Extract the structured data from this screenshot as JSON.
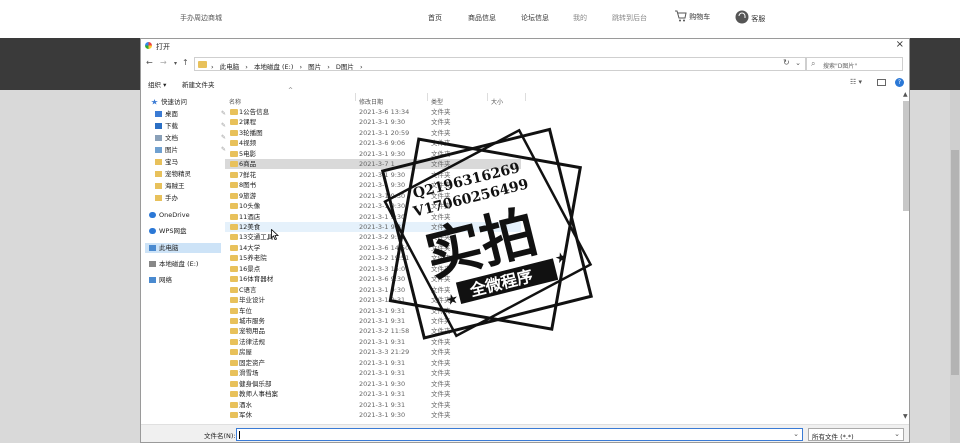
{
  "site": {
    "logo": "手办周边商城",
    "nav": [
      {
        "label": "首页",
        "dim": false
      },
      {
        "label": "商品信息",
        "dim": false
      },
      {
        "label": "论坛信息",
        "dim": false
      },
      {
        "label": "我的",
        "dim": true
      },
      {
        "label": "跳转到后台",
        "dim": true
      },
      {
        "label": "购物车",
        "dim": false
      },
      {
        "label": "客服",
        "dim": false
      }
    ]
  },
  "dialog": {
    "title": "打开",
    "close": "×",
    "breadcrumbs": [
      "此电脑",
      "›",
      "本地磁盘 (E:)",
      "›",
      "图片",
      "›",
      "D图片",
      "›"
    ],
    "search_placeholder": "搜索\"D图片\"",
    "toolbar": {
      "organize": "组织 ▾",
      "new_folder": "新建文件夹"
    },
    "columns": {
      "name": "名称",
      "date": "修改日期",
      "type": "类型",
      "size": "大小"
    },
    "sidebar": [
      {
        "label": "快速访问",
        "icon": "star-icon",
        "color": "#3b7bd4"
      },
      {
        "label": "桌面",
        "icon": "desktop-icon",
        "color": "#3b7bd4",
        "pin": true
      },
      {
        "label": "下载",
        "icon": "download-icon",
        "color": "#2b6fc4",
        "pin": true
      },
      {
        "label": "文档",
        "icon": "document-icon",
        "color": "#8aa0b8",
        "pin": true
      },
      {
        "label": "图片",
        "icon": "picture-icon",
        "color": "#6fa0d0",
        "pin": true
      },
      {
        "label": "宝马",
        "icon": "folder-icon",
        "color": "#e8c15b"
      },
      {
        "label": "宠物精灵",
        "icon": "folder-icon",
        "color": "#e8c15b"
      },
      {
        "label": "海贼王",
        "icon": "folder-icon",
        "color": "#e8c15b"
      },
      {
        "label": "手办",
        "icon": "folder-icon",
        "color": "#e8c15b"
      },
      {
        "label": "OneDrive",
        "icon": "cloud-icon",
        "color": "#2b78d6"
      },
      {
        "label": "WPS网盘",
        "icon": "cloud-icon",
        "color": "#2b78d6"
      },
      {
        "label": "此电脑",
        "icon": "computer-icon",
        "color": "#4a8ad0",
        "selected": true
      },
      {
        "label": "本地磁盘 (E:)",
        "icon": "drive-icon",
        "color": "#888888"
      },
      {
        "label": "网络",
        "icon": "network-icon",
        "color": "#4a8ad0"
      }
    ],
    "files": [
      {
        "name": "1公告信息",
        "date": "2021-3-6 13:34",
        "type": "文件夹"
      },
      {
        "name": "2课程",
        "date": "2021-3-1 9:30",
        "type": "文件夹"
      },
      {
        "name": "3轮播图",
        "date": "2021-3-1 20:59",
        "type": "文件夹"
      },
      {
        "name": "4视频",
        "date": "2021-3-6 9:06",
        "type": "文件夹"
      },
      {
        "name": "5电影",
        "date": "2021-3-1 9:30",
        "type": "文件夹"
      },
      {
        "name": "6商品",
        "date": "2021-3-7 1",
        "type": "文件夹",
        "selected": true
      },
      {
        "name": "7鲜花",
        "date": "2021-3-1 9:30",
        "type": "文件夹"
      },
      {
        "name": "8图书",
        "date": "2021-3-1 9:30",
        "type": "文件夹"
      },
      {
        "name": "9旅游",
        "date": "2021-3-1 9:30",
        "type": "文件夹"
      },
      {
        "name": "10头像",
        "date": "2021-3-1 9:30",
        "type": "文件夹"
      },
      {
        "name": "11酒店",
        "date": "2021-3-1 9:30",
        "type": "文件夹"
      },
      {
        "name": "12美食",
        "date": "2021-3-1 9:31",
        "type": "文件夹",
        "hover": true
      },
      {
        "name": "13交通工具",
        "date": "2021-3-2 9:15",
        "type": "文件夹"
      },
      {
        "name": "14大学",
        "date": "2021-3-6 14:50",
        "type": "文件夹"
      },
      {
        "name": "15养老院",
        "date": "2021-3-2 19:51",
        "type": "文件夹"
      },
      {
        "name": "16景点",
        "date": "2021-3-3 15:01",
        "type": "文件夹"
      },
      {
        "name": "16体育器材",
        "date": "2021-3-6 9:30",
        "type": "文件夹"
      },
      {
        "name": "C语言",
        "date": "2021-3-1 9:30",
        "type": "文件夹"
      },
      {
        "name": "毕业设计",
        "date": "2021-3-1 9:31",
        "type": "文件夹"
      },
      {
        "name": "车位",
        "date": "2021-3-1 9:31",
        "type": "文件夹"
      },
      {
        "name": "城市服务",
        "date": "2021-3-1 9:31",
        "type": "文件夹"
      },
      {
        "name": "宠物用品",
        "date": "2021-3-2 11:58",
        "type": "文件夹"
      },
      {
        "name": "法律法规",
        "date": "2021-3-1 9:31",
        "type": "文件夹"
      },
      {
        "name": "房屋",
        "date": "2021-3-3 21:29",
        "type": "文件夹"
      },
      {
        "name": "固定资产",
        "date": "2021-3-1 9:31",
        "type": "文件夹"
      },
      {
        "name": "滑雪场",
        "date": "2021-3-1 9:31",
        "type": "文件夹"
      },
      {
        "name": "健身俱乐部",
        "date": "2021-3-1 9:30",
        "type": "文件夹"
      },
      {
        "name": "教师人事档案",
        "date": "2021-3-1 9:31",
        "type": "文件夹"
      },
      {
        "name": "酒水",
        "date": "2021-3-1 9:31",
        "type": "文件夹"
      },
      {
        "name": "军休",
        "date": "2021-3-1 9:30",
        "type": "文件夹"
      }
    ],
    "footer": {
      "filename_label": "文件名(N):",
      "filename_value": "",
      "filetype": "所有文件 (*.*)"
    }
  },
  "watermark": {
    "line1": "Q2196316269",
    "line2": "V17060256499",
    "big": "实拍",
    "banner": "全微程序"
  },
  "colors": {
    "accent": "#2b78d6",
    "folder": "#e8c15b",
    "selection": "#cde3f7"
  }
}
